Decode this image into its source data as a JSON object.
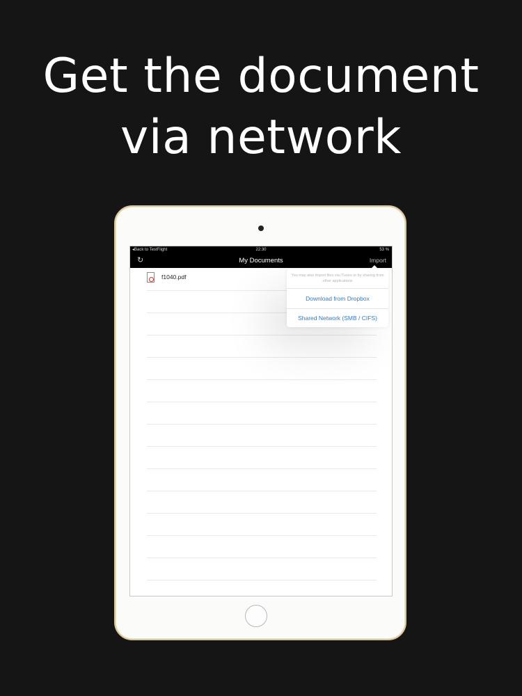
{
  "headline": {
    "line1": "Get the document",
    "line2": "via network"
  },
  "statusbar": {
    "back": "◂Back to TestFlight",
    "time": "22:30",
    "battery": "53 %"
  },
  "navbar": {
    "title": "My Documents",
    "import": "Import",
    "refresh_icon": "refresh-icon"
  },
  "documents": [
    {
      "name": "f1040.pdf",
      "icon": "pdf-icon"
    }
  ],
  "popover": {
    "hint": "You may also import files via iTunes or by sharing from other applications",
    "options": [
      "Download from Dropbox",
      "Shared Network (SMB / CIFS)"
    ]
  },
  "colors": {
    "background": "#161515",
    "accent": "#2f7bd1",
    "device_bezel": "#d9c697"
  }
}
